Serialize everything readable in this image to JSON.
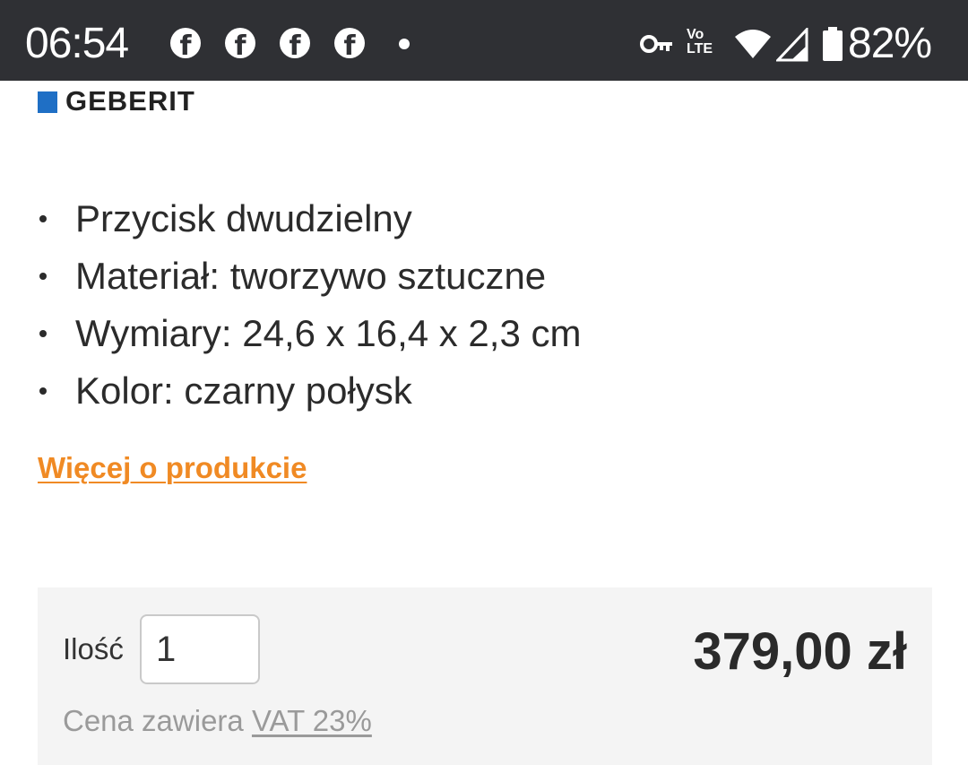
{
  "status_bar": {
    "time": "06:54",
    "notification_icons": [
      "facebook-icon",
      "facebook-icon",
      "facebook-icon",
      "facebook-icon"
    ],
    "volte": "VoLTE",
    "battery": "82%"
  },
  "brand": {
    "name": "GEBERIT",
    "color": "#1f6fc5"
  },
  "features": [
    "Przycisk dwudzielny",
    "Materiał: tworzywo sztuczne",
    "Wymiary: 24,6 x 16,4 x 2,3 cm",
    "Kolor: czarny połysk"
  ],
  "more_link": "Więcej o produkcie",
  "buy": {
    "qty_label": "Ilość",
    "qty_value": "1",
    "price": "379,00 zł",
    "vat_prefix": "Cena zawiera",
    "vat_link": "VAT 23%"
  },
  "colors": {
    "accent": "#f08a24",
    "statusbar": "#2f3034"
  }
}
